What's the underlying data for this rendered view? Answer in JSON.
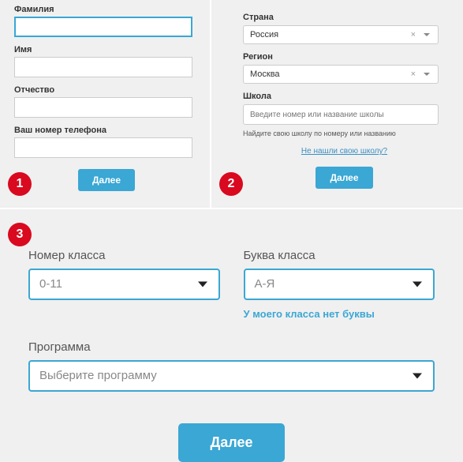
{
  "panel1": {
    "surname_label": "Фамилия",
    "name_label": "Имя",
    "patronymic_label": "Отчество",
    "phone_label": "Ваш номер телефона",
    "next_btn": "Далее"
  },
  "panel2": {
    "country_label": "Страна",
    "country_value": "Россия",
    "region_label": "Регион",
    "region_value": "Москва",
    "school_label": "Школа",
    "school_placeholder": "Введите номер или название школы",
    "school_hint": "Найдите свою школу по номеру или названию",
    "no_school_link": "Не нашли свою школу?",
    "next_btn": "Далее"
  },
  "panel3": {
    "class_num_label": "Номер класса",
    "class_num_value": "0-11",
    "class_letter_label": "Буква класса",
    "class_letter_value": "А-Я",
    "no_letter_link": "У моего класса нет буквы",
    "program_label": "Программа",
    "program_value": "Выберите программу",
    "next_btn": "Далее"
  },
  "badges": {
    "b1": "1",
    "b2": "2",
    "b3": "3"
  }
}
